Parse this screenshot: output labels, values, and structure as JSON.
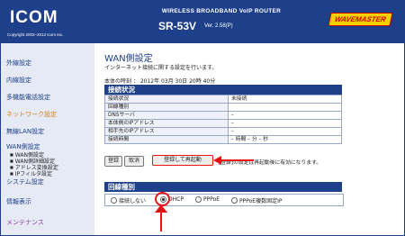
{
  "header": {
    "logo": "ICOM",
    "copyright": "Copyright 2002–2012 Icom Inc.",
    "product": "WIRELESS BROADBAND VoIP ROUTER",
    "model": "SR-53V",
    "version": "Ver. 2.58(P)",
    "brand": "WAVEMASTER"
  },
  "sidebar": {
    "items": [
      {
        "label": "外線設定"
      },
      {
        "label": "内線設定"
      },
      {
        "label": "多機能電話設定"
      },
      {
        "label": "ネットワーク設定"
      },
      {
        "label": "無線LAN設定"
      },
      {
        "label": "WAN側設定"
      },
      {
        "label": "WAN側設定"
      },
      {
        "label": "WAN側詳細設定"
      },
      {
        "label": "アドレス変換設定"
      },
      {
        "label": "IPフィルタ設定"
      },
      {
        "label": "システム設定"
      },
      {
        "label": "情報表示"
      },
      {
        "label": "メンテナンス"
      }
    ]
  },
  "main": {
    "title": "WAN側設定",
    "description": "インターネット接続に関する設定を行います。",
    "time_text": "本体の時刻 ： 2012年 03月 30日 20時 40分",
    "status": {
      "heading": "接続状況",
      "rows": [
        {
          "label": "接続状況",
          "value": "未接続"
        },
        {
          "label": "回線種別",
          "value": ""
        },
        {
          "label": "DNSサーバ",
          "value": "–"
        },
        {
          "label": "本体側のIPアドレス",
          "value": "–"
        },
        {
          "label": "相手先のIPアドレス",
          "value": "–"
        },
        {
          "label": "接続時間",
          "value": "– 時間 – 分 – 秒"
        }
      ]
    },
    "buttons": {
      "register": "登録",
      "cancel": "取消",
      "register_restart": "登録して再起動"
    },
    "note": "[登録]の設定は再起動後に有効になります。",
    "line_type": {
      "heading": "回線種別",
      "options": [
        "接続しない",
        "DHCP",
        "PPPoE",
        "PPPoE複数固定IP"
      ],
      "selected": "DHCP"
    }
  },
  "colors": {
    "header_bg": "#1e3f8a",
    "sidebar_bg": "#e6eaf4",
    "highlight": "#e11111",
    "accent_orange": "#d9811a"
  }
}
